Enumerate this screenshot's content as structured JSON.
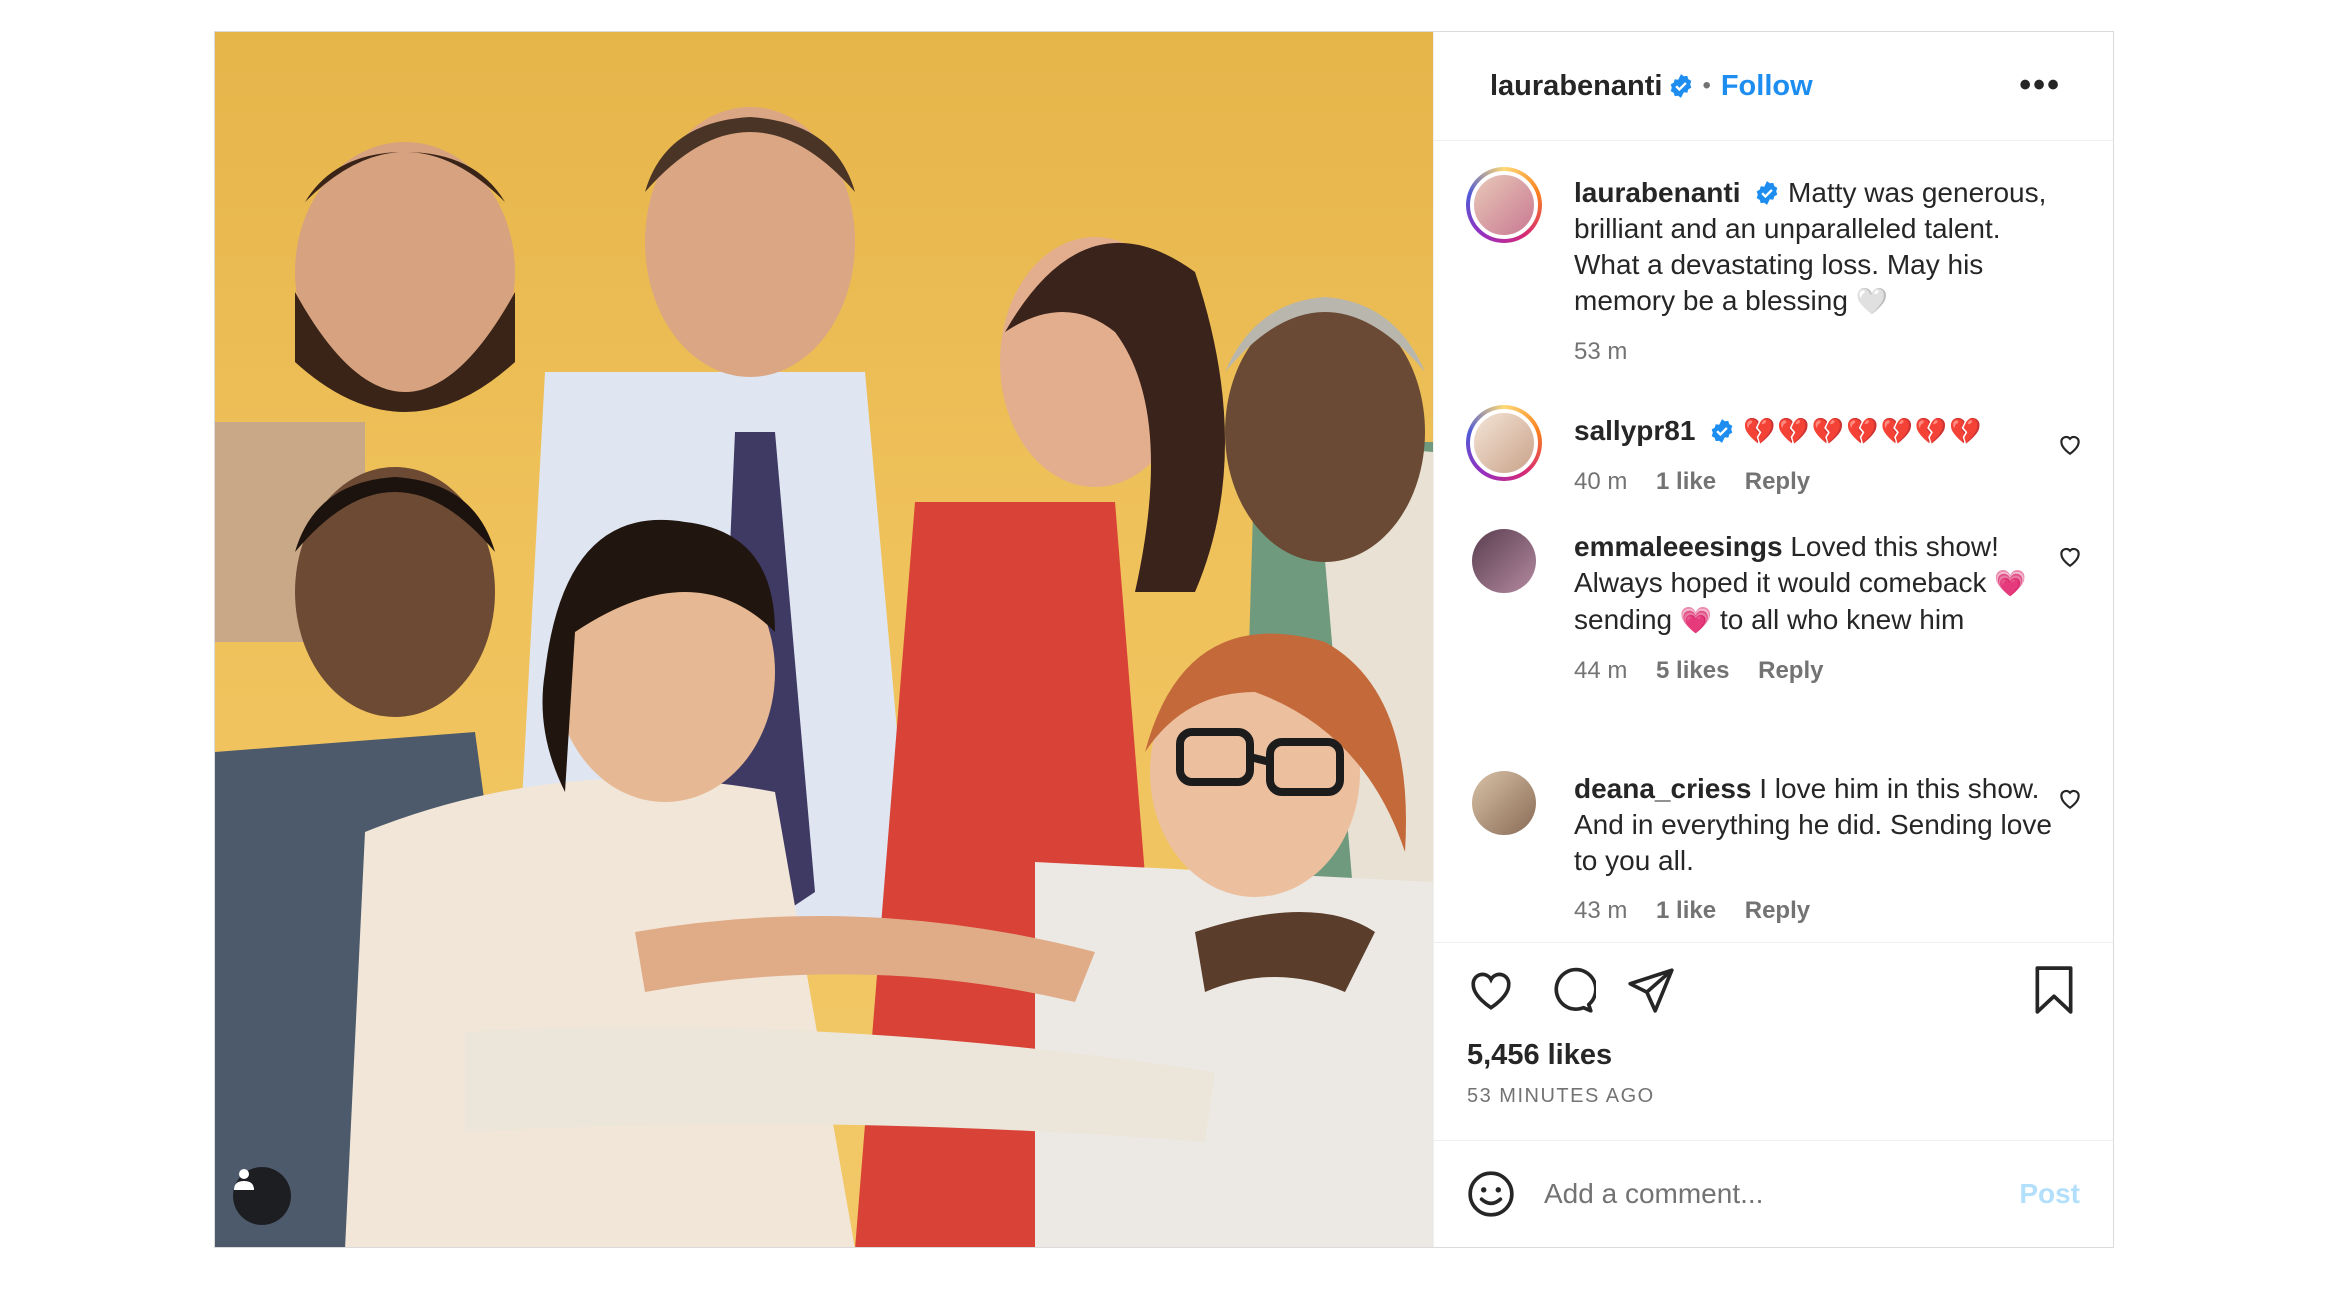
{
  "header": {
    "username": "laurabenanti",
    "separator": "•",
    "follow_label": "Follow",
    "more_label": "•••",
    "icons": [
      "verified-badge-icon",
      "more-options-icon"
    ]
  },
  "caption": {
    "username": "laurabenanti",
    "text": "Matty was generous, brilliant and an unparalleled talent. What a devastating loss. May his memory be a blessing",
    "emoji": "🤍",
    "time": "53 m"
  },
  "comments": [
    {
      "username": "sallypr81",
      "text": "💔💔💔💔💔💔💔",
      "time": "40 m",
      "likes": "1 like",
      "reply": "Reply"
    },
    {
      "username": "emmaleeesings",
      "text_a": "Loved this show! Always hoped it would comeback",
      "emoji_a": "💗",
      "text_b": "sending",
      "emoji_b": "💗",
      "text_c": "to all who knew him",
      "time": "44 m",
      "likes": "5 likes",
      "reply": "Reply"
    },
    {
      "username": "deana_criess",
      "text": "I love him in this show. And in everything he did. Sending love to you all.",
      "time": "43 m",
      "likes": "1 like",
      "reply": "Reply"
    }
  ],
  "actions": {
    "icons": [
      "heart-icon",
      "comment-icon",
      "share-icon",
      "bookmark-icon"
    ],
    "likes_count": "5,456 likes",
    "posted_time": "53 MINUTES AGO"
  },
  "composer": {
    "placeholder": "Add a comment...",
    "post_label": "Post"
  },
  "colors": {
    "follow_blue": "#1d8ef0",
    "post_disabled": "#b2dffc",
    "photo_background": "#efc15a"
  }
}
